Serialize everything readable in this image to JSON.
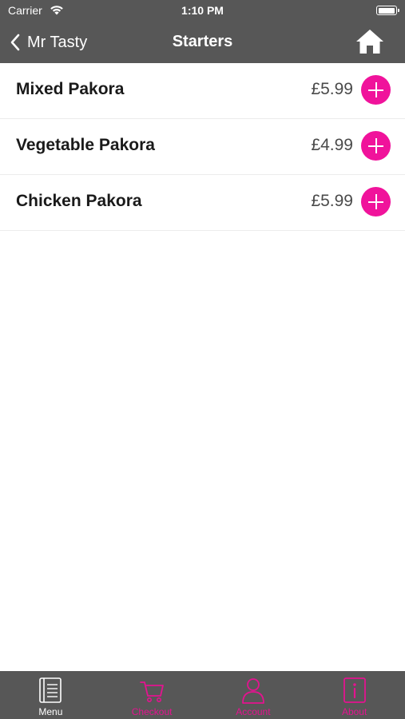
{
  "status_bar": {
    "carrier": "Carrier",
    "time": "1:10 PM",
    "battery_level": 1.0
  },
  "navbar": {
    "back_label": "Mr Tasty",
    "title": "Starters",
    "home_icon": "home-icon",
    "back_icon": "chevron-left-icon"
  },
  "menu_items": [
    {
      "name": "Mixed Pakora",
      "price": "£5.99"
    },
    {
      "name": "Vegetable Pakora",
      "price": "£4.99"
    },
    {
      "name": "Chicken Pakora",
      "price": "£5.99"
    }
  ],
  "tabs": [
    {
      "label": "Menu",
      "icon": "menu-book-icon",
      "active": true
    },
    {
      "label": "Checkout",
      "icon": "cart-icon",
      "active": false
    },
    {
      "label": "Account",
      "icon": "person-icon",
      "active": false
    },
    {
      "label": "About",
      "icon": "info-icon",
      "active": false
    }
  ],
  "colors": {
    "bar_background": "#575757",
    "accent": "#f0139b",
    "tab_active": "#ffffff",
    "tab_inactive": "#e3138f"
  }
}
